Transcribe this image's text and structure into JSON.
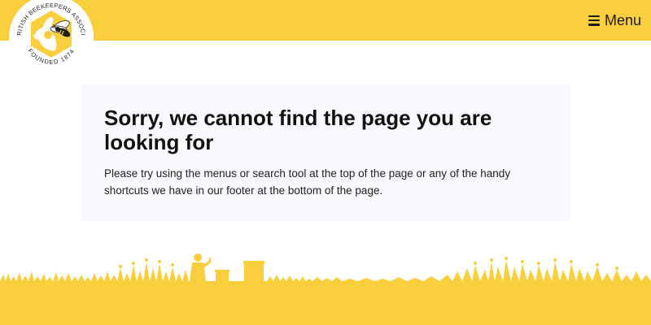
{
  "header": {
    "logo": {
      "ring_text_top": "THE BRITISH BEEKEEPERS ASSOCIATION",
      "ring_text_bottom": "FOUNDED 1874",
      "icon": "bee-hexagon-logo"
    },
    "menu": {
      "icon": "hamburger-icon",
      "label": "Menu"
    }
  },
  "main": {
    "title": "Sorry, we cannot find the page you are looking for",
    "message": "Please try using the menus or search tool at the top of the page or any of the handy shortcuts we have in our footer at the bottom of the page."
  },
  "colors": {
    "brand_yellow": "#f9cf3e",
    "card_background": "#f8f9fc",
    "text_dark": "#111111"
  },
  "decoration": {
    "scene_icon": "beekeeper-meadow-silhouette"
  }
}
